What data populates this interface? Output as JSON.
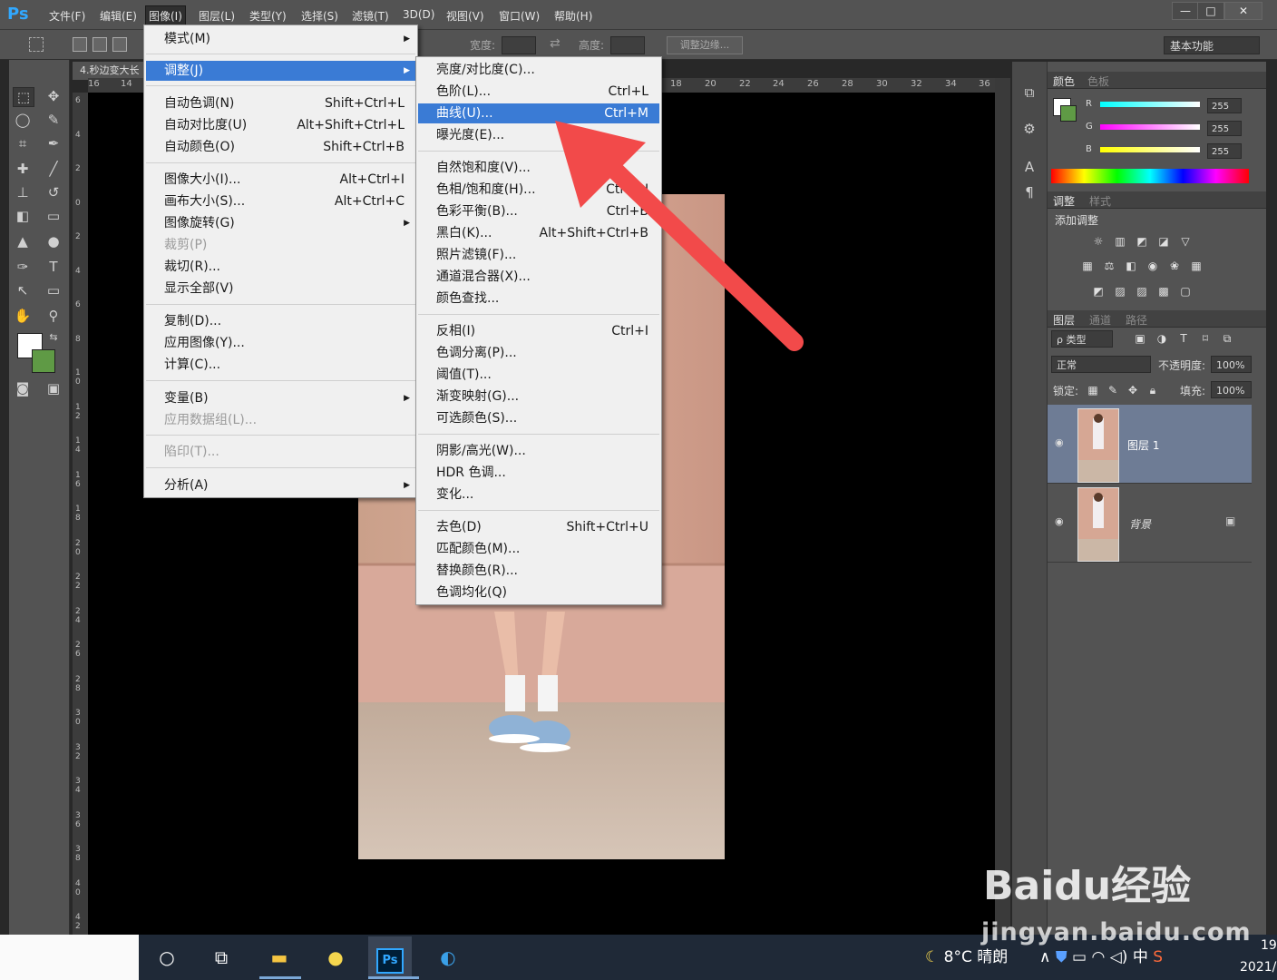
{
  "app": {
    "logo": "Ps"
  },
  "menubar": {
    "items": [
      "文件(F)",
      "编辑(E)",
      "图像(I)",
      "图层(L)",
      "类型(Y)",
      "选择(S)",
      "滤镜(T)",
      "3D(D)",
      "视图(V)",
      "窗口(W)",
      "帮助(H)"
    ],
    "active": "图像(I)",
    "window_buttons": [
      "—",
      "□",
      "✕"
    ]
  },
  "options": {
    "width_label": "宽度:",
    "height_label": "高度:",
    "refine_edge": "调整边缘...",
    "workspace": "基本功能"
  },
  "document": {
    "tab_title": "4.秒边变大长",
    "ruler_top": [
      "16",
      "14",
      "18",
      "20",
      "22",
      "24",
      "26",
      "28",
      "30",
      "32",
      "34",
      "36"
    ],
    "ruler_left": [
      "6",
      "4",
      "2",
      "0",
      "2",
      "4",
      "6",
      "8",
      "1 0",
      "1 2",
      "1 4",
      "1 6",
      "1 8",
      "2 0",
      "2 2",
      "2 4",
      "2 6",
      "2 8",
      "3 0",
      "3 2",
      "3 4",
      "3 6",
      "3 8",
      "4 0",
      "4 2"
    ]
  },
  "image_menu": {
    "items": [
      {
        "label": "模式(M)",
        "shortcut": "",
        "submenu": true
      },
      {
        "label": "调整(J)",
        "shortcut": "",
        "submenu": true,
        "highlighted": true
      },
      {
        "label": "自动色调(N)",
        "shortcut": "Shift+Ctrl+L"
      },
      {
        "label": "自动对比度(U)",
        "shortcut": "Alt+Shift+Ctrl+L"
      },
      {
        "label": "自动颜色(O)",
        "shortcut": "Shift+Ctrl+B"
      },
      {
        "label": "图像大小(I)...",
        "shortcut": "Alt+Ctrl+I"
      },
      {
        "label": "画布大小(S)...",
        "shortcut": "Alt+Ctrl+C"
      },
      {
        "label": "图像旋转(G)",
        "shortcut": "",
        "submenu": true
      },
      {
        "label": "裁剪(P)",
        "shortcut": "",
        "disabled": true
      },
      {
        "label": "裁切(R)...",
        "shortcut": ""
      },
      {
        "label": "显示全部(V)",
        "shortcut": ""
      },
      {
        "label": "复制(D)...",
        "shortcut": ""
      },
      {
        "label": "应用图像(Y)...",
        "shortcut": ""
      },
      {
        "label": "计算(C)...",
        "shortcut": ""
      },
      {
        "label": "变量(B)",
        "shortcut": "",
        "submenu": true
      },
      {
        "label": "应用数据组(L)...",
        "shortcut": "",
        "disabled": true
      },
      {
        "label": "陷印(T)...",
        "shortcut": "",
        "disabled": true
      },
      {
        "label": "分析(A)",
        "shortcut": "",
        "submenu": true
      }
    ]
  },
  "adjust_menu": {
    "items": [
      {
        "label": "亮度/对比度(C)...",
        "shortcut": ""
      },
      {
        "label": "色阶(L)...",
        "shortcut": "Ctrl+L"
      },
      {
        "label": "曲线(U)...",
        "shortcut": "Ctrl+M",
        "highlighted": true
      },
      {
        "label": "曝光度(E)...",
        "shortcut": ""
      },
      {
        "label": "自然饱和度(V)...",
        "shortcut": ""
      },
      {
        "label": "色相/饱和度(H)...",
        "shortcut": "Ctrl+U"
      },
      {
        "label": "色彩平衡(B)...",
        "shortcut": "Ctrl+B"
      },
      {
        "label": "黑白(K)...",
        "shortcut": "Alt+Shift+Ctrl+B"
      },
      {
        "label": "照片滤镜(F)...",
        "shortcut": ""
      },
      {
        "label": "通道混合器(X)...",
        "shortcut": ""
      },
      {
        "label": "颜色查找...",
        "shortcut": ""
      },
      {
        "label": "反相(I)",
        "shortcut": "Ctrl+I"
      },
      {
        "label": "色调分离(P)...",
        "shortcut": ""
      },
      {
        "label": "阈值(T)...",
        "shortcut": ""
      },
      {
        "label": "渐变映射(G)...",
        "shortcut": ""
      },
      {
        "label": "可选颜色(S)...",
        "shortcut": ""
      },
      {
        "label": "阴影/高光(W)...",
        "shortcut": ""
      },
      {
        "label": "HDR 色调...",
        "shortcut": ""
      },
      {
        "label": "变化...",
        "shortcut": ""
      },
      {
        "label": "去色(D)",
        "shortcut": "Shift+Ctrl+U"
      },
      {
        "label": "匹配颜色(M)...",
        "shortcut": ""
      },
      {
        "label": "替换颜色(R)...",
        "shortcut": ""
      },
      {
        "label": "色调均化(Q)",
        "shortcut": ""
      }
    ]
  },
  "color_panel": {
    "tabs": [
      "颜色",
      "色板"
    ],
    "channels": [
      {
        "label": "R",
        "value": "255",
        "color": "#80ffff"
      },
      {
        "label": "G",
        "value": "255",
        "color": "#ff80ff"
      },
      {
        "label": "B",
        "value": "255",
        "color": "#ffff40"
      }
    ]
  },
  "adjustments_panel": {
    "tabs": [
      "调整",
      "样式"
    ],
    "title": "添加调整"
  },
  "layers_panel": {
    "tabs": [
      "图层",
      "通道",
      "路径"
    ],
    "filter": "ρ 类型",
    "blend_mode": "正常",
    "opacity_label": "不透明度:",
    "opacity": "100%",
    "lock_label": "锁定:",
    "fill_label": "填充:",
    "fill": "100%",
    "layers": [
      {
        "name": "图层 1",
        "selected": true
      },
      {
        "name": "背景",
        "locked": true
      }
    ]
  },
  "taskbar": {
    "weather_temp": "8°C",
    "weather_text": "晴朗",
    "ime": "中",
    "clock_time": "19",
    "clock_date": "2021/"
  },
  "watermark": {
    "text": "jingyan.baidu.com",
    "brand": "Baidu经验"
  },
  "colors": {
    "accent": "#3a7bd5",
    "arrow": "#f24a4a",
    "layer_selected": "#6e7c95"
  }
}
